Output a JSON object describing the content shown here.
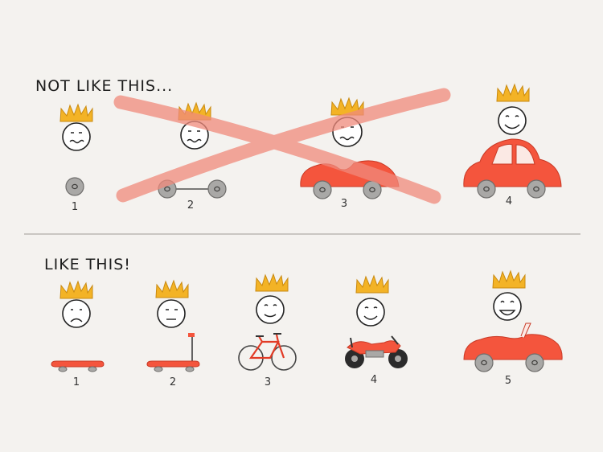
{
  "headings": {
    "not_like_this": "NOT LIKE THIS...",
    "like_this": "LIKE THIS!"
  },
  "top_row": {
    "labels": [
      "1",
      "2",
      "3",
      "4"
    ],
    "stages": [
      "wheel",
      "skateboard-axle",
      "car-body",
      "car"
    ],
    "crossed_out": true
  },
  "bottom_row": {
    "labels": [
      "1",
      "2",
      "3",
      "4",
      "5"
    ],
    "stages": [
      "skateboard",
      "scooter",
      "bicycle",
      "motorcycle",
      "convertible"
    ]
  },
  "colors": {
    "vehicle": "#f4553d",
    "crown": "#f3b326",
    "cross": "#f08a7c",
    "wheel": "#a9a8a6"
  }
}
